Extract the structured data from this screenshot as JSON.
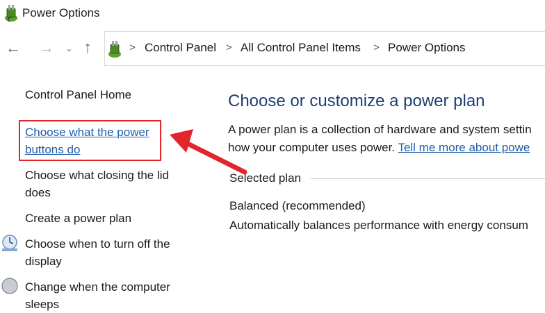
{
  "window": {
    "title": "Power Options",
    "icon": "power-options-icon"
  },
  "nav": {
    "back_icon": "back-arrow-icon",
    "forward_icon": "forward-arrow-icon",
    "recent_icon": "chevron-down-icon",
    "up_icon": "up-arrow-icon"
  },
  "breadcrumb": {
    "items": [
      "Control Panel",
      "All Control Panel Items",
      "Power Options"
    ],
    "separator": ">"
  },
  "sidebar": {
    "home_label": "Control Panel Home",
    "links": [
      {
        "label": "Choose what the power buttons do",
        "line1": "Choose what the power",
        "line2": "buttons do",
        "highlighted": true
      },
      {
        "label": "Choose what closing the lid does",
        "line1": "Choose what closing the lid",
        "line2": "does"
      },
      {
        "label": "Create a power plan",
        "line1": "Create a power plan"
      },
      {
        "label": "Choose when to turn off the display",
        "line1": "Choose when to turn off the",
        "line2": "display",
        "icon": "monitor-icon"
      },
      {
        "label": "Change when the computer sleeps",
        "line1": "Change when the computer",
        "line2": "sleeps",
        "icon": "moon-sleep-icon"
      }
    ]
  },
  "main": {
    "heading": "Choose or customize a power plan",
    "desc_line1": "A power plan is a collection of hardware and system settin",
    "desc_line2_prefix": "how your computer uses power. ",
    "desc_link": "Tell me more about powe",
    "selected_plan_label": "Selected plan",
    "plan_name": "Balanced (recommended)",
    "plan_desc": "Automatically balances performance with energy consum"
  },
  "annotation": {
    "highlight_color": "#e3242b",
    "arrow_color": "#e3242b"
  },
  "colors": {
    "link": "#1f5da8",
    "heading": "#1e3f73"
  }
}
